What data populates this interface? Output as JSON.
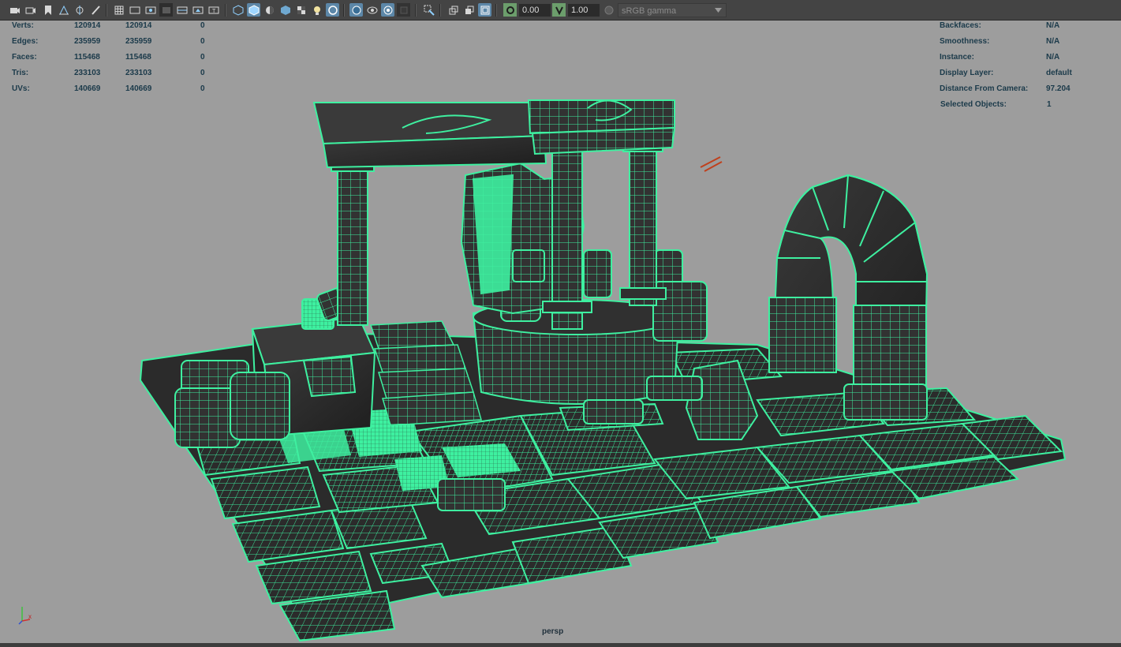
{
  "toolbar": {
    "field_1": "0.00",
    "field_2": "1.00",
    "color_space": "sRGB gamma",
    "icons": [
      "camera-icon",
      "camera-attributes-icon",
      "bookmark-icon",
      "image-plane-icon",
      "grid-snap-icon",
      "pan-zoom-icon",
      "grease-pencil-icon",
      "grid-icon",
      "film-gate-icon",
      "resolution-gate-icon",
      "gate-mask-icon",
      "field-chart-icon",
      "safe-action-icon",
      "safe-title-icon",
      "wireframe-icon",
      "smooth-shade-icon",
      "default-material-icon",
      "textured-icon",
      "shadows-icon",
      "lighting-icon",
      "xray-icon",
      "xray-active-icon",
      "xray-joints-icon",
      "backface-icon",
      "isolate-select-icon",
      "highlight-icon",
      "screen-space-ao-icon",
      "motion-blur-icon",
      "exposure-icon",
      "gamma-icon",
      "color-management-icon"
    ]
  },
  "hud_left": {
    "rows": [
      {
        "label": "Verts:",
        "object": "120914",
        "selected": "120914",
        "components": "0"
      },
      {
        "label": "Edges:",
        "object": "235959",
        "selected": "235959",
        "components": "0"
      },
      {
        "label": "Faces:",
        "object": "115468",
        "selected": "115468",
        "components": "0"
      },
      {
        "label": "Tris:",
        "object": "233103",
        "selected": "233103",
        "components": "0"
      },
      {
        "label": "UVs:",
        "object": "140669",
        "selected": "140669",
        "components": "0"
      }
    ]
  },
  "hud_right": {
    "rows": [
      {
        "label": "Backfaces:",
        "value": "N/A"
      },
      {
        "label": "Smoothness:",
        "value": "N/A"
      },
      {
        "label": "Instance:",
        "value": "N/A"
      },
      {
        "label": "Display Layer:",
        "value": "default"
      },
      {
        "label": "Distance From Camera:",
        "value": "97.204"
      },
      {
        "label": "Selected Objects:",
        "value": "1"
      }
    ]
  },
  "viewport": {
    "camera_name": "persp",
    "wire_color": "#3ef0a0",
    "solid_color": "#2a2a2a",
    "background_color": "#9d9d9d"
  },
  "axis": {
    "x": "x",
    "y": "y",
    "z": "z"
  }
}
